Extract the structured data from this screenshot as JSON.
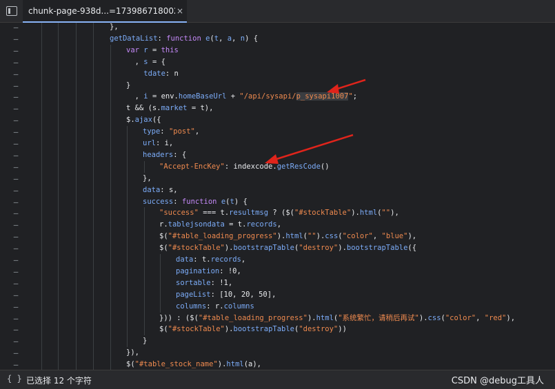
{
  "tab": {
    "title": "chunk-page-938d...=1739867180027",
    "close": "×"
  },
  "editor": {
    "gutter_marker": "–",
    "lines": [
      {
        "indent": 4,
        "tokens": [
          {
            "t": "},",
            "c": "pl"
          }
        ]
      },
      {
        "indent": 4,
        "tokens": [
          {
            "t": "getDataList",
            "c": "prop"
          },
          {
            "t": ": ",
            "c": "pl"
          },
          {
            "t": "function",
            "c": "kw"
          },
          {
            "t": " ",
            "c": "pl"
          },
          {
            "t": "e",
            "c": "prop"
          },
          {
            "t": "(",
            "c": "pl"
          },
          {
            "t": "t",
            "c": "prop"
          },
          {
            "t": ", ",
            "c": "pl"
          },
          {
            "t": "a",
            "c": "prop"
          },
          {
            "t": ", ",
            "c": "pl"
          },
          {
            "t": "n",
            "c": "prop"
          },
          {
            "t": ") {",
            "c": "pl"
          }
        ]
      },
      {
        "indent": 5,
        "tokens": [
          {
            "t": "var",
            "c": "kw"
          },
          {
            "t": " ",
            "c": "pl"
          },
          {
            "t": "r",
            "c": "prop"
          },
          {
            "t": " = ",
            "c": "pl"
          },
          {
            "t": "this",
            "c": "kw"
          }
        ]
      },
      {
        "indent": 5,
        "tokens": [
          {
            "t": "  , ",
            "c": "pl"
          },
          {
            "t": "s",
            "c": "prop"
          },
          {
            "t": " = {",
            "c": "pl"
          }
        ]
      },
      {
        "indent": 5,
        "tokens": [
          {
            "t": "    ",
            "c": "pl"
          },
          {
            "t": "tdate",
            "c": "prop"
          },
          {
            "t": ": n",
            "c": "pl"
          }
        ]
      },
      {
        "indent": 5,
        "tokens": [
          {
            "t": "}",
            "c": "pl"
          }
        ]
      },
      {
        "indent": 5,
        "tokens": [
          {
            "t": "  , ",
            "c": "pl"
          },
          {
            "t": "i",
            "c": "prop"
          },
          {
            "t": " = env.",
            "c": "pl"
          },
          {
            "t": "homeBaseUrl",
            "c": "prop"
          },
          {
            "t": " + ",
            "c": "pl"
          },
          {
            "t": "\"/api/sysapi/",
            "c": "str"
          },
          {
            "t": "p_sysapi1007",
            "c": "str",
            "hl": true
          },
          {
            "t": "\"",
            "c": "str"
          },
          {
            "t": ";",
            "c": "pl"
          }
        ]
      },
      {
        "indent": 5,
        "tokens": [
          {
            "t": "t && (s.",
            "c": "pl"
          },
          {
            "t": "market",
            "c": "prop"
          },
          {
            "t": " = t),",
            "c": "pl"
          }
        ]
      },
      {
        "indent": 5,
        "tokens": [
          {
            "t": "$.",
            "c": "pl"
          },
          {
            "t": "ajax",
            "c": "prop"
          },
          {
            "t": "({",
            "c": "pl"
          }
        ]
      },
      {
        "indent": 6,
        "tokens": [
          {
            "t": "type",
            "c": "prop"
          },
          {
            "t": ": ",
            "c": "pl"
          },
          {
            "t": "\"post\"",
            "c": "str"
          },
          {
            "t": ",",
            "c": "pl"
          }
        ]
      },
      {
        "indent": 6,
        "tokens": [
          {
            "t": "url",
            "c": "prop"
          },
          {
            "t": ": i,",
            "c": "pl"
          }
        ]
      },
      {
        "indent": 6,
        "tokens": [
          {
            "t": "headers",
            "c": "prop"
          },
          {
            "t": ": {",
            "c": "pl"
          }
        ]
      },
      {
        "indent": 7,
        "tokens": [
          {
            "t": "\"Accept-EncKey\"",
            "c": "str"
          },
          {
            "t": ": indexcode.",
            "c": "pl"
          },
          {
            "t": "getResCode",
            "c": "prop"
          },
          {
            "t": "()",
            "c": "pl"
          }
        ]
      },
      {
        "indent": 6,
        "tokens": [
          {
            "t": "},",
            "c": "pl"
          }
        ]
      },
      {
        "indent": 6,
        "tokens": [
          {
            "t": "data",
            "c": "prop"
          },
          {
            "t": ": s,",
            "c": "pl"
          }
        ]
      },
      {
        "indent": 6,
        "tokens": [
          {
            "t": "success",
            "c": "prop"
          },
          {
            "t": ": ",
            "c": "pl"
          },
          {
            "t": "function",
            "c": "kw"
          },
          {
            "t": " ",
            "c": "pl"
          },
          {
            "t": "e",
            "c": "prop"
          },
          {
            "t": "(",
            "c": "pl"
          },
          {
            "t": "t",
            "c": "prop"
          },
          {
            "t": ") {",
            "c": "pl"
          }
        ]
      },
      {
        "indent": 7,
        "tokens": [
          {
            "t": "\"success\"",
            "c": "str"
          },
          {
            "t": " === t.",
            "c": "pl"
          },
          {
            "t": "resultmsg",
            "c": "prop"
          },
          {
            "t": " ? ($(",
            "c": "pl"
          },
          {
            "t": "\"#stockTable\"",
            "c": "str"
          },
          {
            "t": ").",
            "c": "pl"
          },
          {
            "t": "html",
            "c": "prop"
          },
          {
            "t": "(",
            "c": "pl"
          },
          {
            "t": "\"\"",
            "c": "str"
          },
          {
            "t": "),",
            "c": "pl"
          }
        ]
      },
      {
        "indent": 7,
        "tokens": [
          {
            "t": "r.",
            "c": "pl"
          },
          {
            "t": "tablejsondata",
            "c": "prop"
          },
          {
            "t": " = t.",
            "c": "pl"
          },
          {
            "t": "records",
            "c": "prop"
          },
          {
            "t": ",",
            "c": "pl"
          }
        ]
      },
      {
        "indent": 7,
        "tokens": [
          {
            "t": "$(",
            "c": "pl"
          },
          {
            "t": "\"#table_loading_progress\"",
            "c": "str"
          },
          {
            "t": ").",
            "c": "pl"
          },
          {
            "t": "html",
            "c": "prop"
          },
          {
            "t": "(",
            "c": "pl"
          },
          {
            "t": "\"\"",
            "c": "str"
          },
          {
            "t": ").",
            "c": "pl"
          },
          {
            "t": "css",
            "c": "prop"
          },
          {
            "t": "(",
            "c": "pl"
          },
          {
            "t": "\"color\"",
            "c": "str"
          },
          {
            "t": ", ",
            "c": "pl"
          },
          {
            "t": "\"blue\"",
            "c": "str"
          },
          {
            "t": "),",
            "c": "pl"
          }
        ]
      },
      {
        "indent": 7,
        "tokens": [
          {
            "t": "$(",
            "c": "pl"
          },
          {
            "t": "\"#stockTable\"",
            "c": "str"
          },
          {
            "t": ").",
            "c": "pl"
          },
          {
            "t": "bootstrapTable",
            "c": "prop"
          },
          {
            "t": "(",
            "c": "pl"
          },
          {
            "t": "\"destroy\"",
            "c": "str"
          },
          {
            "t": ").",
            "c": "pl"
          },
          {
            "t": "bootstrapTable",
            "c": "prop"
          },
          {
            "t": "({",
            "c": "pl"
          }
        ]
      },
      {
        "indent": 8,
        "tokens": [
          {
            "t": "data",
            "c": "prop"
          },
          {
            "t": ": t.",
            "c": "pl"
          },
          {
            "t": "records",
            "c": "prop"
          },
          {
            "t": ",",
            "c": "pl"
          }
        ]
      },
      {
        "indent": 8,
        "tokens": [
          {
            "t": "pagination",
            "c": "prop"
          },
          {
            "t": ": !0,",
            "c": "pl"
          }
        ]
      },
      {
        "indent": 8,
        "tokens": [
          {
            "t": "sortable",
            "c": "prop"
          },
          {
            "t": ": !1,",
            "c": "pl"
          }
        ]
      },
      {
        "indent": 8,
        "tokens": [
          {
            "t": "pageList",
            "c": "prop"
          },
          {
            "t": ": [10, 20, 50],",
            "c": "pl"
          }
        ]
      },
      {
        "indent": 8,
        "tokens": [
          {
            "t": "columns",
            "c": "prop"
          },
          {
            "t": ": r.",
            "c": "pl"
          },
          {
            "t": "columns",
            "c": "prop"
          }
        ]
      },
      {
        "indent": 7,
        "tokens": [
          {
            "t": "})) : ($(",
            "c": "pl"
          },
          {
            "t": "\"#table_loading_progress\"",
            "c": "str"
          },
          {
            "t": ").",
            "c": "pl"
          },
          {
            "t": "html",
            "c": "prop"
          },
          {
            "t": "(",
            "c": "pl"
          },
          {
            "t": "\"系统繁忙，请稍后再试\"",
            "c": "str"
          },
          {
            "t": ").",
            "c": "pl"
          },
          {
            "t": "css",
            "c": "prop"
          },
          {
            "t": "(",
            "c": "pl"
          },
          {
            "t": "\"color\"",
            "c": "str"
          },
          {
            "t": ", ",
            "c": "pl"
          },
          {
            "t": "\"red\"",
            "c": "str"
          },
          {
            "t": "),",
            "c": "pl"
          }
        ]
      },
      {
        "indent": 7,
        "tokens": [
          {
            "t": "$(",
            "c": "pl"
          },
          {
            "t": "\"#stockTable\"",
            "c": "str"
          },
          {
            "t": ").",
            "c": "pl"
          },
          {
            "t": "bootstrapTable",
            "c": "prop"
          },
          {
            "t": "(",
            "c": "pl"
          },
          {
            "t": "\"destroy\"",
            "c": "str"
          },
          {
            "t": "))",
            "c": "pl"
          }
        ]
      },
      {
        "indent": 6,
        "tokens": [
          {
            "t": "}",
            "c": "pl"
          }
        ]
      },
      {
        "indent": 5,
        "tokens": [
          {
            "t": "}),",
            "c": "pl"
          }
        ]
      },
      {
        "indent": 5,
        "tokens": [
          {
            "t": "$(",
            "c": "pl"
          },
          {
            "t": "\"#table_stock_name\"",
            "c": "str"
          },
          {
            "t": ").",
            "c": "pl"
          },
          {
            "t": "html",
            "c": "prop"
          },
          {
            "t": "(a),",
            "c": "pl"
          }
        ]
      }
    ]
  },
  "status": {
    "pretty_print": "{ }",
    "selection": "已选择 12 个字符",
    "watermark": "CSDN @debug工具人"
  },
  "colors": {
    "property": "#7cacf8",
    "keyword": "#c58af9",
    "string": "#ee8a4f",
    "annotation_arrow": "#e0241b",
    "active_tab_underline": "#8ab4f8"
  },
  "icons": {
    "panel_toggle": "sidebar-toggle-icon",
    "annotation": "red-arrow-annotation"
  }
}
